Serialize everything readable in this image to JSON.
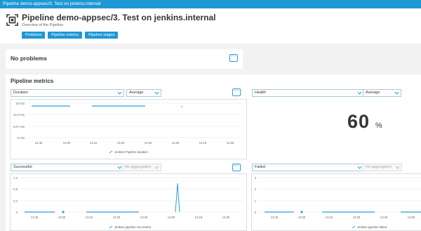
{
  "window": {
    "title": "Pipeline demo-appsec/3. Test on jenkins.internal"
  },
  "header": {
    "title": "Pipeline demo-appsec/3. Test on jenkins.internal",
    "subtitle": "Overview of the Pipeline",
    "tabs": [
      {
        "label": "Problems"
      },
      {
        "label": "Pipeline metrics"
      },
      {
        "label": "Pipeline stages"
      }
    ]
  },
  "problems": {
    "title": "No problems",
    "more": "···"
  },
  "metrics": {
    "title": "Pipeline metrics",
    "duration": {
      "metric": "Duration",
      "aggregation": "Average",
      "more": "···",
      "legend": "Jenkins Pipeline duration",
      "y_ticks": [
        "20 min",
        "13.3 min",
        "6.67 min",
        "0 min"
      ],
      "x_ticks": [
        "12:45",
        "13:00",
        "13:15",
        "13:30",
        "13:45",
        "14:00",
        "14:15",
        "14:30"
      ]
    },
    "health": {
      "metric": "Health",
      "aggregation": "Average",
      "value": "60",
      "unit": "%"
    },
    "successful": {
      "metric": "Successful",
      "aggregation": "No aggregation",
      "more": "···",
      "legend": "Jenkins pipeline successful",
      "y_ticks": [
        "1.2",
        "0.8",
        "0.4",
        "0"
      ],
      "x_ticks": [
        "12:45",
        "13:00",
        "13:15",
        "13:30",
        "13:45",
        "14:00",
        "14:15",
        "14:30"
      ]
    },
    "failed": {
      "metric": "Failed",
      "aggregation": "No aggregation",
      "legend": "Jenkins pipeline failed",
      "y_ticks": [
        "3",
        "2",
        "1",
        "0"
      ],
      "x_ticks": [
        "12:45",
        "13:00",
        "13:15",
        "13:30",
        "13:45",
        "14:00"
      ]
    }
  },
  "colors": {
    "accent": "#1e98d4",
    "series": "#2a9fd8"
  }
}
